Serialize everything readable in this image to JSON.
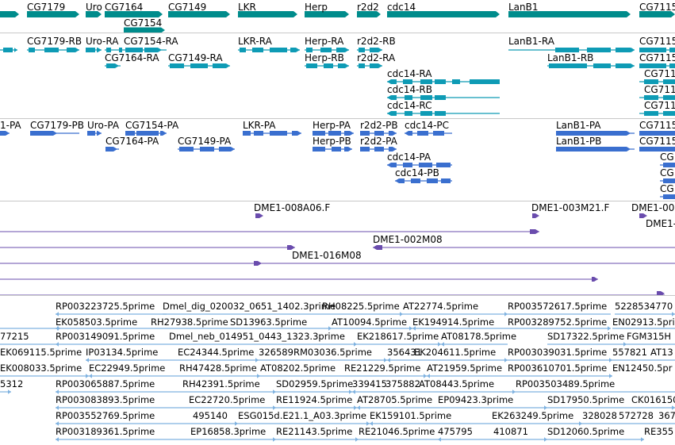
{
  "tracks": {
    "gene_span": {
      "color": "#008c8c",
      "labels": [
        "CG7179",
        "Uro",
        "CG7164",
        "CG7149",
        "LKR",
        "Herp",
        "r2d2",
        "cdc14",
        "LanB1",
        "CG7115",
        "CG7154"
      ]
    },
    "transcripts": {
      "color": "#0e9bb5",
      "labels": [
        "CG7179-RB",
        "Uro-RA",
        "CG7154-RA",
        "LKR-RA",
        "Herp-RA",
        "r2d2-RB",
        "LanB1-RA",
        "CG7115",
        "CG7164-RA",
        "CG7149-RA",
        "Herp-RB",
        "r2d2-RA",
        "LanB1-RB",
        "CG7115",
        "cdc14-RA",
        "CG711",
        "cdc14-RB",
        "CG711",
        "cdc14-RC",
        "CG711"
      ]
    },
    "proteins": {
      "color": "#3a6fcf",
      "labels": [
        "1-PA",
        "CG7179-PB",
        "Uro-PA",
        "CG7154-PA",
        "LKR-PA",
        "Herp-PA",
        "r2d2-PB",
        "cdc14-PC",
        "LanB1-PA",
        "CG7115",
        "CG7164-PA",
        "CG7149-PA",
        "Herp-PB",
        "r2d2-PA",
        "LanB1-PB",
        "CG7115",
        "cdc14-PA",
        "CG",
        "cdc14-PB",
        "CG",
        "CG"
      ]
    },
    "clones": {
      "color": "#6a4cad",
      "labels": [
        "DME1-008A06.F",
        "DME1-003M21.F",
        "DME1-00",
        "DME1-",
        "DME1-002M08",
        "DME1-016M08"
      ]
    },
    "ests": {
      "color": "#7fb2e0",
      "labels": [
        "RP003223725.5prime",
        "Dmel_dig_020032_0651_1402.3prime",
        "RH08225.5prime",
        "AT22774.5prime",
        "RP003572617.5prime",
        "5228534770",
        "EK058503.5prime",
        "RH27938.5prime",
        "SD13963.5prime",
        "AT10094.5prime",
        "EK194914.5prime",
        "RP003289752.5prime",
        "EN02913.5prime",
        "77215",
        "SD17322.5prime",
        "FGM315H",
        "EK069115.5prime",
        "RP003149091.5prime",
        "Dmel_neb_014951_0443_1323.3prime",
        "EK218617.5prime",
        "AT08178.5prime",
        "IP03134.5prime",
        "EC24344.5prime",
        "326589",
        "RM03036.5prime",
        "356431",
        "EK204611.5prime",
        "RP003039031.5prime",
        "557821",
        "AT13",
        "EK008033.5prime",
        "EC22949.5prime",
        "RH47428.5prime",
        "AT08202.5prime",
        "RE21229.5prime",
        "AT21959.5prime",
        "RP003610701.5prime",
        "EN12450.5pr",
        "5312",
        "RP003065887.5prime",
        "RH42391.5prime",
        "SD02959.5prime",
        "339415",
        "375882",
        "AT08443.5prime",
        "RP003503489.5prime",
        "RP003083893.5prime",
        "EC22720.5prime",
        "RE11924.5prime",
        "AT28705.5prime",
        "EP09423.3prime",
        "SD17950.5prime",
        "CK016150",
        "RP003552769.5prime",
        "495140",
        "ESG015d.E21.1_A03.3prime",
        "EK159101.5prime",
        "EK263249.5prime",
        "328028",
        "572728",
        "367",
        "RP003189361.5prime",
        "EP16858.3prime",
        "RE21143.5prime",
        "RE21046.5prime",
        "475795",
        "410871",
        "SD12060.5prime",
        "RE355"
      ]
    }
  }
}
